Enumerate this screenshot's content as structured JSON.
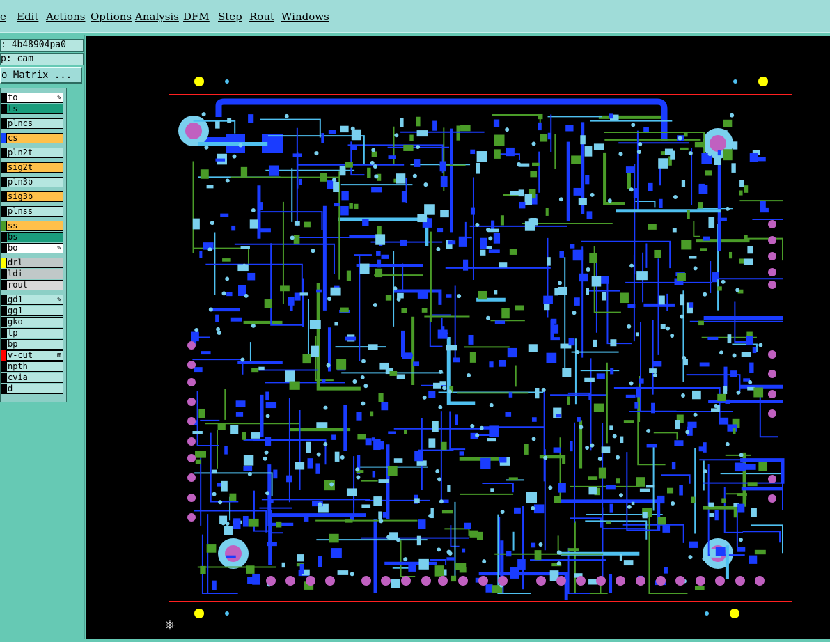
{
  "menu": [
    "e",
    "Edit",
    "Actions",
    "Options",
    "Analysis",
    "DFM",
    "Step",
    "Rout",
    "Windows"
  ],
  "info": {
    "job": ":  4b48904pa0",
    "step": "p: cam",
    "matrix_button": "o Matrix ..."
  },
  "layers": [
    {
      "name": "to",
      "bg": "#ffffff",
      "swatch": "#000000",
      "mark": "✎"
    },
    {
      "name": "ts",
      "bg": "#1a9c7c",
      "swatch": "#000000",
      "mark": ""
    },
    {
      "name": "plncs",
      "bg": "#b5e6e0",
      "swatch": "#000000",
      "mark": ""
    },
    {
      "name": "cs",
      "bg": "#ffc04a",
      "swatch": "#1444ff",
      "mark": ""
    },
    {
      "name": "pln2t",
      "bg": "#b5e6e0",
      "swatch": "#000000",
      "mark": ""
    },
    {
      "name": "sig2t",
      "bg": "#ffc04a",
      "swatch": "#000000",
      "mark": ""
    },
    {
      "name": "pln3b",
      "bg": "#b5e6e0",
      "swatch": "#000000",
      "mark": ""
    },
    {
      "name": "sig3b",
      "bg": "#ffc04a",
      "swatch": "#000000",
      "mark": ""
    },
    {
      "name": "plnss",
      "bg": "#b5e6e0",
      "swatch": "#000000",
      "mark": ""
    },
    {
      "name": "ss",
      "bg": "#ffc04a",
      "swatch": "#4a9c28",
      "mark": ""
    },
    {
      "name": "bs",
      "bg": "#1a9c7c",
      "swatch": "#000000",
      "mark": ""
    },
    {
      "name": "bo",
      "bg": "#ffffff",
      "swatch": "#000000",
      "mark": "✎"
    },
    {
      "name": "drl",
      "bg": "#c0c8c8",
      "swatch": "#ffff00",
      "mark": ""
    },
    {
      "name": "ldi",
      "bg": "#c0c8c8",
      "swatch": "#000000",
      "mark": ""
    },
    {
      "name": "rout",
      "bg": "#d8d8d8",
      "swatch": "#000000",
      "mark": ""
    },
    {
      "name": "gd1",
      "bg": "#b5e6e0",
      "swatch": "#000000",
      "mark": "✎"
    },
    {
      "name": "gg1",
      "bg": "#b5e6e0",
      "swatch": "#000000",
      "mark": ""
    },
    {
      "name": "gko",
      "bg": "#b5e6e0",
      "swatch": "#000000",
      "mark": ""
    },
    {
      "name": "tp",
      "bg": "#b5e6e0",
      "swatch": "#000000",
      "mark": ""
    },
    {
      "name": "bp",
      "bg": "#b5e6e0",
      "swatch": "#000000",
      "mark": ""
    },
    {
      "name": "v-cut",
      "bg": "#b5e6e0",
      "swatch": "#ff0000",
      "mark": "⊞"
    },
    {
      "name": "npth",
      "bg": "#b5e6e0",
      "swatch": "#000000",
      "mark": ""
    },
    {
      "name": "cvia",
      "bg": "#b5e6e0",
      "swatch": "#000000",
      "mark": ""
    },
    {
      "name": "d",
      "bg": "#b5e6e0",
      "swatch": "#000000",
      "mark": ""
    }
  ],
  "colors": {
    "top_copper": "#1a3cff",
    "inner_copper": "#4fc0f0",
    "silk_green": "#4a9c28",
    "pad_magenta": "#c060c0",
    "pad_lightblue": "#7ad0ee",
    "fiducial_yellow": "#ffff00",
    "board_outline_red": "#ff2020",
    "canvas_black": "#000000"
  },
  "icons": {
    "ucs_marker": "crosshair-icon"
  }
}
